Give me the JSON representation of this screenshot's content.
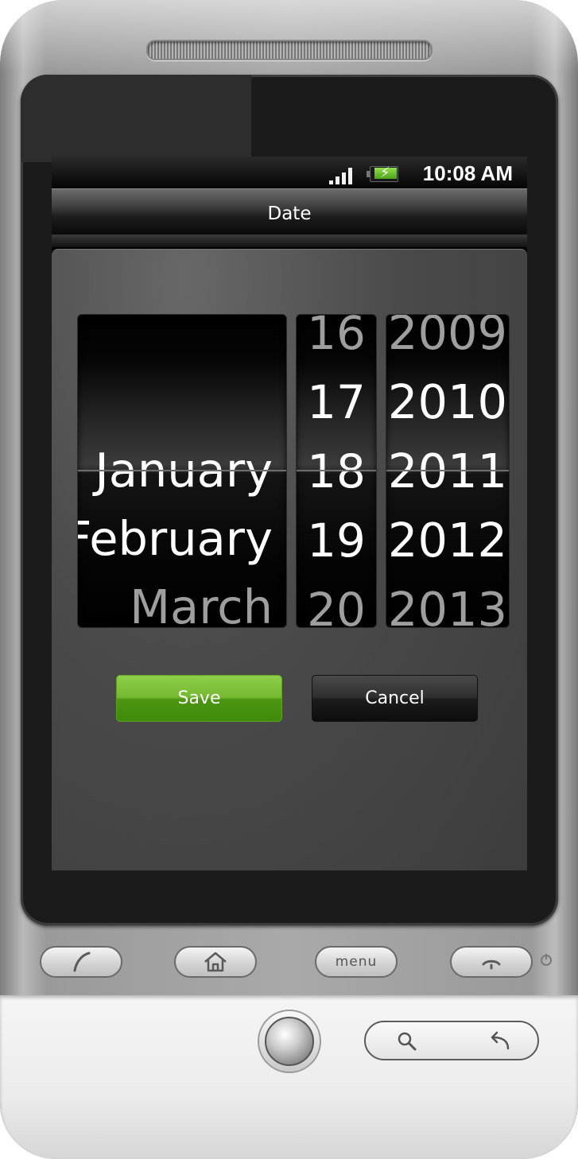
{
  "status_bar": {
    "time": "10:08 AM",
    "signal_icon": "signal-bars-icon",
    "battery_icon": "battery-charging-icon"
  },
  "dialog": {
    "title": "Date",
    "save_label": "Save",
    "cancel_label": "Cancel"
  },
  "picker": {
    "month": {
      "items": [
        "January",
        "February",
        "March"
      ],
      "selected": "January"
    },
    "day": {
      "items": [
        "16",
        "17",
        "18",
        "19",
        "20"
      ],
      "selected": "18"
    },
    "year": {
      "items": [
        "2009",
        "2010",
        "2011",
        "2012",
        "2013"
      ],
      "selected": "2011"
    }
  },
  "hardware_keys": {
    "menu_label": "menu",
    "call_icon": "phone-call-icon",
    "home_icon": "home-icon",
    "end_call_icon": "end-call-icon",
    "search_icon": "search-icon",
    "back_icon": "back-arrow-icon"
  },
  "colors": {
    "save_accent": "#74b830",
    "cancel_bg": "#1c1c1c",
    "screen_bg": "#000000"
  }
}
